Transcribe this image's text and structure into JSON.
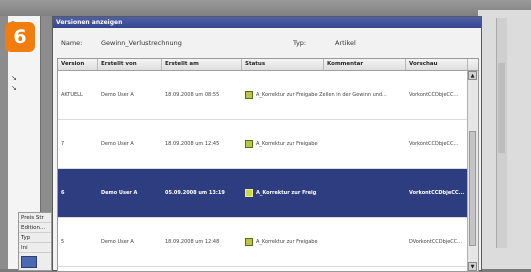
{
  "step": "6",
  "dialog": {
    "title": "Versionen anzeigen",
    "name_label": "Name:",
    "name_value": "Gewinn_Verlustrechnung",
    "type_label": "Typ:",
    "type_value": "Artikel"
  },
  "grid": {
    "columns": [
      "Version",
      "Erstellt von",
      "Erstellt am",
      "Status",
      "Kommentar",
      "Vorschau"
    ],
    "rows": [
      {
        "version": "AKTUELL",
        "author": "Demo User A",
        "date": "18.09.2008 um 08:55",
        "status": "A_Korrektur zur Freigabe Zeilen in der Gewinn und...",
        "comment": "",
        "preview": "VorkontCCDbjeCC...",
        "selected": false
      },
      {
        "version": "7",
        "author": "Demo User A",
        "date": "18.09.2008 um 12:45",
        "status": "A_Korrektur zur Freigabe",
        "comment": "",
        "preview": "VorkontCCDbjeCC...",
        "selected": false
      },
      {
        "version": "6",
        "author": "Demo User A",
        "date": "05.09.2008 um 13:19",
        "status": "A_Korrektur zur Freig",
        "comment": "",
        "preview": "VorkontCCDbjeCC...",
        "selected": true
      },
      {
        "version": "5",
        "author": "Demo User A",
        "date": "18.09.2008 um 12:48",
        "status": "A_Korrektur zur Freigabe",
        "comment": "",
        "preview": "DVorkontCCDbjeCC...",
        "selected": false
      }
    ]
  },
  "background": {
    "left_lower_rows": [
      "Preis Str",
      "Edition...",
      "Typ",
      "Ini"
    ]
  },
  "colors": {
    "badge": "#f07d0d",
    "titlebar": "#3c4c96",
    "selected_row": "#2e3d80",
    "status_square": "#b7c54a"
  }
}
